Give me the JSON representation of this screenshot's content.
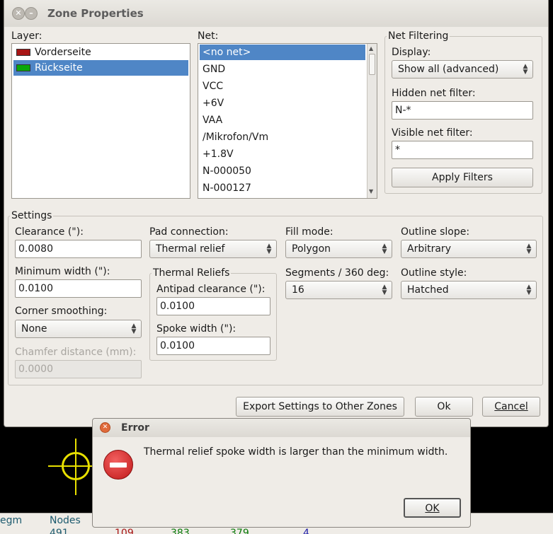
{
  "window": {
    "title": "Zone Properties"
  },
  "layer": {
    "label": "Layer:",
    "items": [
      {
        "name": "Vorderseite",
        "color": "#a81515"
      },
      {
        "name": "Rückseite",
        "color": "#0aa70a"
      }
    ]
  },
  "net": {
    "label": "Net:",
    "items": [
      "<no net>",
      "GND",
      "VCC",
      "+6V",
      "VAA",
      "/Mikrofon/Vm",
      "+1.8V",
      "N-000050",
      "N-000127"
    ]
  },
  "net_filtering": {
    "title": "Net Filtering",
    "display_label": "Display:",
    "display_value": "Show all (advanced)",
    "hidden_label": "Hidden net filter:",
    "hidden_value": "N-*",
    "visible_label": "Visible net filter:",
    "visible_value": "*",
    "apply_label": "Apply Filters"
  },
  "settings": {
    "title": "Settings",
    "clearance_label": "Clearance (\"):",
    "clearance_value": "0.0080",
    "min_width_label": "Minimum width (\"):",
    "min_width_value": "0.0100",
    "corner_label": "Corner smoothing:",
    "corner_value": "None",
    "chamfer_label": "Chamfer distance (mm):",
    "chamfer_value": "0.0000",
    "pad_label": "Pad connection:",
    "pad_value": "Thermal relief",
    "thermal_title": "Thermal Reliefs",
    "antipad_label": "Antipad clearance (\"):",
    "antipad_value": "0.0100",
    "spoke_label": "Spoke width (\"):",
    "spoke_value": "0.0100",
    "fill_label": "Fill mode:",
    "fill_value": "Polygon",
    "segments_label": "Segments / 360 deg:",
    "segments_value": "16",
    "slope_label": "Outline slope:",
    "slope_value": "Arbitrary",
    "style_label": "Outline style:",
    "style_value": "Hatched"
  },
  "buttons": {
    "export": "Export Settings to Other Zones",
    "ok": "Ok",
    "cancel": "Cancel"
  },
  "error": {
    "title": "Error",
    "message": "Thermal relief spoke width is larger than the minimum width.",
    "ok": "OK"
  },
  "background": {
    "headers": [
      "egm",
      "Nodes"
    ],
    "values": [
      "491",
      "109",
      "383",
      "379",
      "4"
    ]
  }
}
